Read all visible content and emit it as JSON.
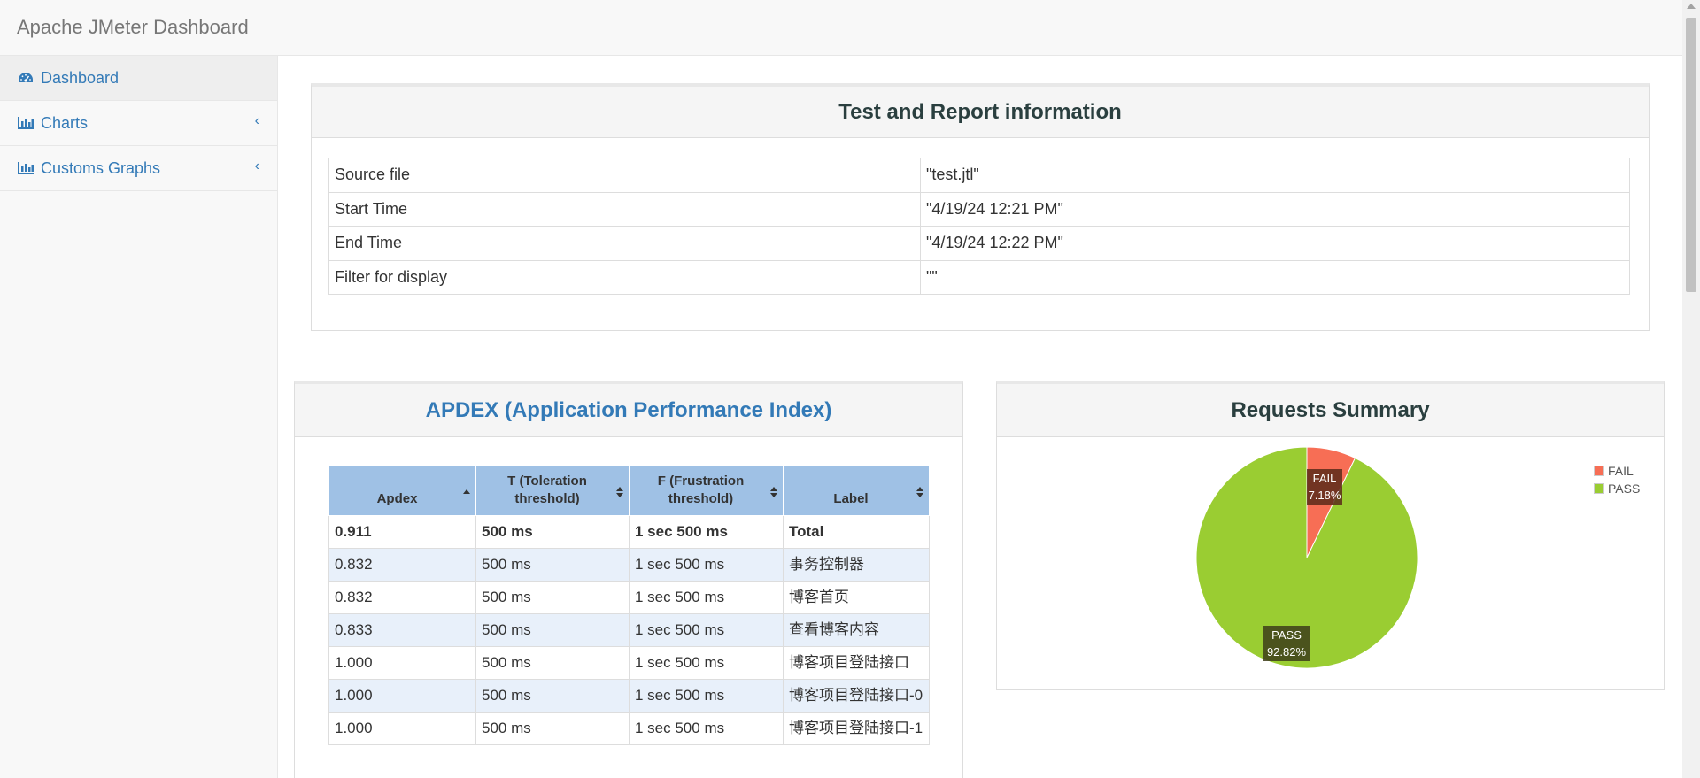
{
  "navbar": {
    "brand": "Apache JMeter Dashboard"
  },
  "sidebar": {
    "items": [
      {
        "label": "Dashboard",
        "icon": "dashboard-icon"
      },
      {
        "label": "Charts",
        "icon": "bar-chart-icon"
      },
      {
        "label": "Customs Graphs",
        "icon": "bar-chart-icon"
      }
    ]
  },
  "test_info": {
    "title": "Test and Report information",
    "rows": [
      {
        "key": "Source file",
        "value": "\"test.jtl\""
      },
      {
        "key": "Start Time",
        "value": "\"4/19/24 12:21 PM\""
      },
      {
        "key": "End Time",
        "value": "\"4/19/24 12:22 PM\""
      },
      {
        "key": "Filter for display",
        "value": "\"\""
      }
    ]
  },
  "apdex": {
    "title": "APDEX (Application Performance Index)",
    "headers": {
      "apdex": "Apdex",
      "t_line1": "T (Toleration",
      "t_line2": "threshold)",
      "f_line1": "F (Frustration",
      "f_line2": "threshold)",
      "label": "Label"
    },
    "rows": [
      {
        "apdex": "0.911",
        "t": "500 ms",
        "f": "1 sec 500 ms",
        "label": "Total"
      },
      {
        "apdex": "0.832",
        "t": "500 ms",
        "f": "1 sec 500 ms",
        "label": "事务控制器"
      },
      {
        "apdex": "0.832",
        "t": "500 ms",
        "f": "1 sec 500 ms",
        "label": "博客首页"
      },
      {
        "apdex": "0.833",
        "t": "500 ms",
        "f": "1 sec 500 ms",
        "label": "查看博客内容"
      },
      {
        "apdex": "1.000",
        "t": "500 ms",
        "f": "1 sec 500 ms",
        "label": "博客项目登陆接口"
      },
      {
        "apdex": "1.000",
        "t": "500 ms",
        "f": "1 sec 500 ms",
        "label": "博客项目登陆接口-0"
      },
      {
        "apdex": "1.000",
        "t": "500 ms",
        "f": "1 sec 500 ms",
        "label": "博客项目登陆接口-1"
      }
    ]
  },
  "requests_summary": {
    "title": "Requests Summary",
    "colors": {
      "fail": "#f76e55",
      "pass": "#9acd32",
      "label_bg": "#3d3d1a"
    },
    "slices": [
      {
        "label": "FAIL",
        "percent": 7.18,
        "percent_text": "7.18%"
      },
      {
        "label": "PASS",
        "percent": 92.82,
        "percent_text": "92.82%"
      }
    ],
    "legend": [
      "FAIL",
      "PASS"
    ]
  }
}
